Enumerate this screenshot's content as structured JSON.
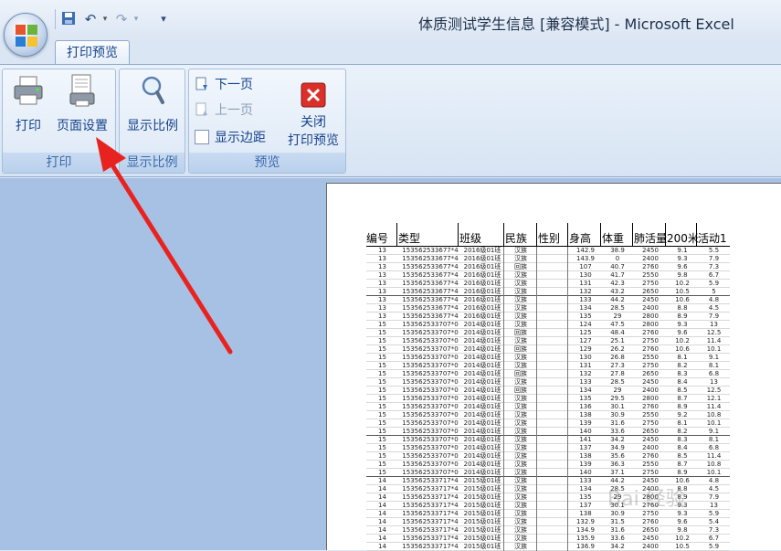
{
  "window": {
    "title": "体质测试学生信息  [兼容模式] - Microsoft Excel"
  },
  "quick_access": {
    "items": [
      "save-icon",
      "undo-icon",
      "redo-icon",
      "customize-icon"
    ]
  },
  "tabs": {
    "active": "打印预览"
  },
  "ribbon": {
    "print_group": {
      "label": "打印",
      "print": "打印",
      "page_setup": "页面设置"
    },
    "zoom_group": {
      "label": "显示比例",
      "zoom": "显示比例"
    },
    "preview_group": {
      "label": "预览",
      "next_page": "下一页",
      "prev_page": "上一页",
      "show_margins": "显示边距",
      "close_line1": "关闭",
      "close_line2": "打印预览"
    }
  },
  "sheet": {
    "headers": [
      "编号",
      "类型",
      "班级",
      "民族",
      "性别",
      "身高",
      "体重",
      "肺活量",
      "200米",
      "活动1"
    ],
    "rows": [
      [
        "13",
        "153562533677*4",
        "2016级01班",
        "汉族",
        "",
        "142.9",
        "38.9",
        "2450",
        "9.1",
        "5.5"
      ],
      [
        "13",
        "153562533677*4",
        "2016级01班",
        "汉族",
        "",
        "143.9",
        "0",
        "2400",
        "9.3",
        "7.9"
      ],
      [
        "13",
        "153562533677*4",
        "2016级01班",
        "回族",
        "",
        "107",
        "40.7",
        "2760",
        "9.6",
        "7.3"
      ],
      [
        "13",
        "153562533677*4",
        "2016级01班",
        "汉族",
        "",
        "130",
        "41.7",
        "2550",
        "9.8",
        "6.7"
      ],
      [
        "13",
        "153562533677*4",
        "2016级01班",
        "汉族",
        "",
        "131",
        "42.3",
        "2750",
        "10.2",
        "5.9"
      ],
      [
        "13",
        "153562533677*4",
        "2016级01班",
        "汉族",
        "",
        "132",
        "43.2",
        "2650",
        "10.5",
        "5"
      ],
      [
        "13",
        "153562533677*4",
        "2016级01班",
        "汉族",
        "",
        "133",
        "44.2",
        "2450",
        "10.6",
        "4.8"
      ],
      [
        "13",
        "153562533677*4",
        "2016级01班",
        "汉族",
        "",
        "134",
        "28.5",
        "2400",
        "8.8",
        "4.5"
      ],
      [
        "13",
        "153562533677*4",
        "2016级01班",
        "汉族",
        "",
        "135",
        "29",
        "2800",
        "8.9",
        "7.9"
      ],
      [
        "15",
        "153562533707*0",
        "2014级01班",
        "汉族",
        "",
        "124",
        "47.5",
        "2800",
        "9.3",
        "13"
      ],
      [
        "15",
        "153562533707*0",
        "2014级01班",
        "回族",
        "",
        "125",
        "48.4",
        "2760",
        "9.6",
        "12.5"
      ],
      [
        "15",
        "153562533707*0",
        "2014级01班",
        "汉族",
        "",
        "127",
        "25.1",
        "2750",
        "10.2",
        "11.4"
      ],
      [
        "15",
        "153562533707*0",
        "2014级01班",
        "回族",
        "",
        "129",
        "26.2",
        "2760",
        "10.6",
        "10.1"
      ],
      [
        "15",
        "153562533707*0",
        "2014级01班",
        "汉族",
        "",
        "130",
        "26.8",
        "2550",
        "8.1",
        "9.1"
      ],
      [
        "15",
        "153562533707*0",
        "2014级01班",
        "汉族",
        "",
        "131",
        "27.3",
        "2750",
        "8.2",
        "8.1"
      ],
      [
        "15",
        "153562533707*0",
        "2014级01班",
        "回族",
        "",
        "132",
        "27.8",
        "2650",
        "8.3",
        "6.8"
      ],
      [
        "15",
        "153562533707*0",
        "2014级01班",
        "汉族",
        "",
        "133",
        "28.5",
        "2450",
        "8.4",
        "13"
      ],
      [
        "15",
        "153562533707*0",
        "2014级01班",
        "回族",
        "",
        "134",
        "29",
        "2400",
        "8.5",
        "12.5"
      ],
      [
        "15",
        "153562533707*0",
        "2014级01班",
        "汉族",
        "",
        "135",
        "29.5",
        "2800",
        "8.7",
        "12.1"
      ],
      [
        "15",
        "153562533707*0",
        "2014级01班",
        "汉族",
        "",
        "136",
        "30.1",
        "2760",
        "8.9",
        "11.4"
      ],
      [
        "15",
        "153562533707*0",
        "2014级01班",
        "汉族",
        "",
        "138",
        "30.9",
        "2550",
        "9.2",
        "10.8"
      ],
      [
        "15",
        "153562533707*0",
        "2014级01班",
        "汉族",
        "",
        "139",
        "31.6",
        "2750",
        "8.1",
        "10.1"
      ],
      [
        "15",
        "153562533707*0",
        "2014级01班",
        "汉族",
        "",
        "140",
        "33.6",
        "2650",
        "8.2",
        "9.1"
      ],
      [
        "15",
        "153562533707*0",
        "2014级01班",
        "汉族",
        "",
        "141",
        "34.2",
        "2450",
        "8.3",
        "8.1"
      ],
      [
        "15",
        "153562533707*0",
        "2014级01班",
        "汉族",
        "",
        "137",
        "34.9",
        "2400",
        "8.4",
        "6.8"
      ],
      [
        "15",
        "153562533707*0",
        "2014级01班",
        "汉族",
        "",
        "138",
        "35.6",
        "2760",
        "8.5",
        "11.4"
      ],
      [
        "15",
        "153562533707*0",
        "2014级01班",
        "汉族",
        "",
        "139",
        "36.3",
        "2550",
        "8.7",
        "10.8"
      ],
      [
        "15",
        "153562533707*0",
        "2014级01班",
        "汉族",
        "",
        "140",
        "37.1",
        "2750",
        "8.9",
        "10.1"
      ],
      [
        "14",
        "153562533717*4",
        "2015级01班",
        "汉族",
        "",
        "133",
        "44.2",
        "2450",
        "10.6",
        "4.8"
      ],
      [
        "14",
        "153562533717*4",
        "2015级01班",
        "汉族",
        "",
        "134",
        "28.5",
        "2400",
        "8.8",
        "4.5"
      ],
      [
        "14",
        "153562533717*4",
        "2015级01班",
        "汉族",
        "",
        "135",
        "29",
        "2800",
        "8.9",
        "7.9"
      ],
      [
        "14",
        "153562533717*4",
        "2015级01班",
        "汉族",
        "",
        "137",
        "30.1",
        "2760",
        "9.3",
        "13"
      ],
      [
        "14",
        "153562533717*4",
        "2015级01班",
        "汉族",
        "",
        "138",
        "30.9",
        "2750",
        "9.3",
        "5.9"
      ],
      [
        "14",
        "153562533717*4",
        "2015级01班",
        "汉族",
        "",
        "132.9",
        "31.5",
        "2760",
        "9.6",
        "5.4"
      ],
      [
        "14",
        "153562533717*4",
        "2015级01班",
        "汉族",
        "",
        "134.9",
        "31.6",
        "2650",
        "9.8",
        "7.3"
      ],
      [
        "14",
        "153562533717*4",
        "2015级01班",
        "汉族",
        "",
        "135.9",
        "33.6",
        "2450",
        "10.2",
        "6.7"
      ],
      [
        "14",
        "153562533717*4",
        "2015级01班",
        "汉族",
        "",
        "136.9",
        "34.2",
        "2400",
        "10.5",
        "5.9"
      ]
    ]
  },
  "watermark": {
    "text": "Bai 经验"
  }
}
